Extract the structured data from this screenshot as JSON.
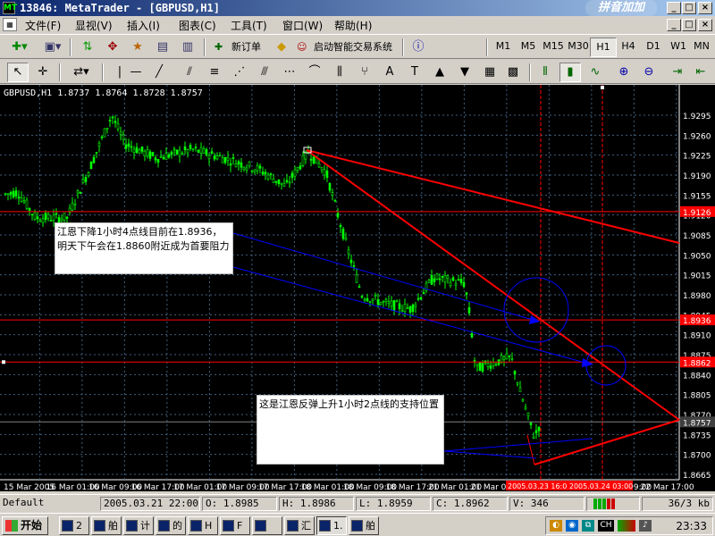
{
  "window": {
    "title": "13846: MetaTrader - [GBPUSD,H1]",
    "logo_text": "拼音加加",
    "min": "_",
    "max": "□",
    "close": "×",
    "inner_min": "_",
    "inner_max": "□",
    "inner_close": "×"
  },
  "menu": {
    "items": [
      "文件(F)",
      "显视(V)",
      "插入(I)",
      "图表(C)",
      "工具(T)",
      "窗口(W)",
      "帮助(H)"
    ]
  },
  "toolbar": {
    "new_order_label": "新订单",
    "expert_label": "启动智能交易系统",
    "timeframes": [
      "M1",
      "M5",
      "M15",
      "M30",
      "H1",
      "H4",
      "D1",
      "W1",
      "MN"
    ],
    "active_timeframe": "H1"
  },
  "chart": {
    "header": "GBPUSD,H1  1.8737 1.8764 1.8728 1.8757",
    "price_labels": [
      "1.9295",
      "1.9260",
      "1.9225",
      "1.9190",
      "1.9155",
      "1.9120",
      "1.9085",
      "1.9050",
      "1.9015",
      "1.8980",
      "1.8945",
      "1.8910",
      "1.8875",
      "1.8840",
      "1.8805",
      "1.8770",
      "1.8735",
      "1.8700",
      "1.8665"
    ],
    "time_labels": [
      "15 Mar 2005",
      "16 Mar 01:00",
      "16 Mar 09:00",
      "16 Mar 17:00",
      "17 Mar 01:00",
      "17 Mar 09:00",
      "17 Mar 17:00",
      "18 Mar 01:00",
      "18 Mar 09:00",
      "18 Mar 17:00",
      "21 Mar 01:00",
      "21 Mar 09:00",
      "21 Mar 17:00",
      "22 Mar 01:00",
      "22 Mar 09:00",
      "22 Mar 17:00"
    ],
    "highlighted_levels": [
      "1.9126",
      "1.8936",
      "1.8862",
      "1.8757"
    ],
    "bottom_highlight": "2005.03.23 16:0   2005.03.24 03:00",
    "annotation1": "江恩下降1小时4点线目前在1.8936，明天下午会在1.8860附近成为首要阻力",
    "annotation2": "这是江恩反弹上升1小时2点线的支持位置"
  },
  "status": {
    "profile": "Default",
    "datetime": "2005.03.21 22:00",
    "open": "O: 1.8985",
    "high": "H: 1.8986",
    "low": "L: 1.8959",
    "close": "C: 1.8962",
    "volume": "V: 346",
    "traffic": "36/3 kb"
  },
  "taskbar": {
    "start_label": "开始",
    "buttons": [
      "2",
      "舶",
      "计",
      "的",
      "H",
      "F",
      "",
      "汇",
      "1.",
      "舶"
    ],
    "active_index": 8,
    "tray_lang": "CH",
    "clock": "23:33"
  },
  "colors": {
    "candle": "#00ff00",
    "trendline_red": "#ff0000",
    "trendline_blue": "#0000ff",
    "grid": "#406080"
  }
}
